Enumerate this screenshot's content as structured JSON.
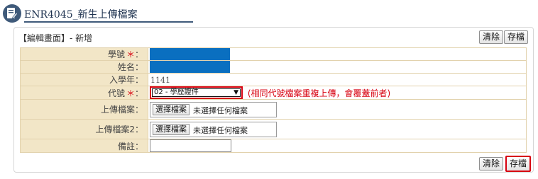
{
  "header": {
    "title": "ENR4045_新生上傳檔案",
    "icon": "edit-document-icon",
    "accent_color": "#3f5a7a"
  },
  "panel": {
    "title": "【編輯畫面】- 新增",
    "top_actions": {
      "clear_label": "清除",
      "save_label": "存檔"
    },
    "bottom_actions": {
      "clear_label": "清除",
      "save_label": "存檔"
    }
  },
  "form": {
    "student_id": {
      "label": "學號",
      "required_mark": "＊",
      "colon": "："
    },
    "name": {
      "label": "姓名",
      "colon": "："
    },
    "entry_year": {
      "label": "入學年",
      "colon": "：",
      "value": "1141"
    },
    "code": {
      "label": "代號",
      "required_mark": "＊",
      "colon": "：",
      "selected": "02 - 學歷證件",
      "note": "(相同代號檔案重複上傳，會覆蓋前者)"
    },
    "upload_1": {
      "label": "上傳檔案",
      "colon": "：",
      "button_label": "選擇檔案",
      "status": "未選擇任何檔案"
    },
    "upload_2": {
      "label": "上傳檔案2",
      "colon": "：",
      "button_label": "選擇檔案",
      "status": "未選擇任何檔案"
    },
    "remark": {
      "label": "備註",
      "colon": "：",
      "value": ""
    }
  },
  "colors": {
    "label_bg": "#f2e6c7",
    "required_red": "#d7000f",
    "redaction_blue": "#0a6fc0"
  }
}
